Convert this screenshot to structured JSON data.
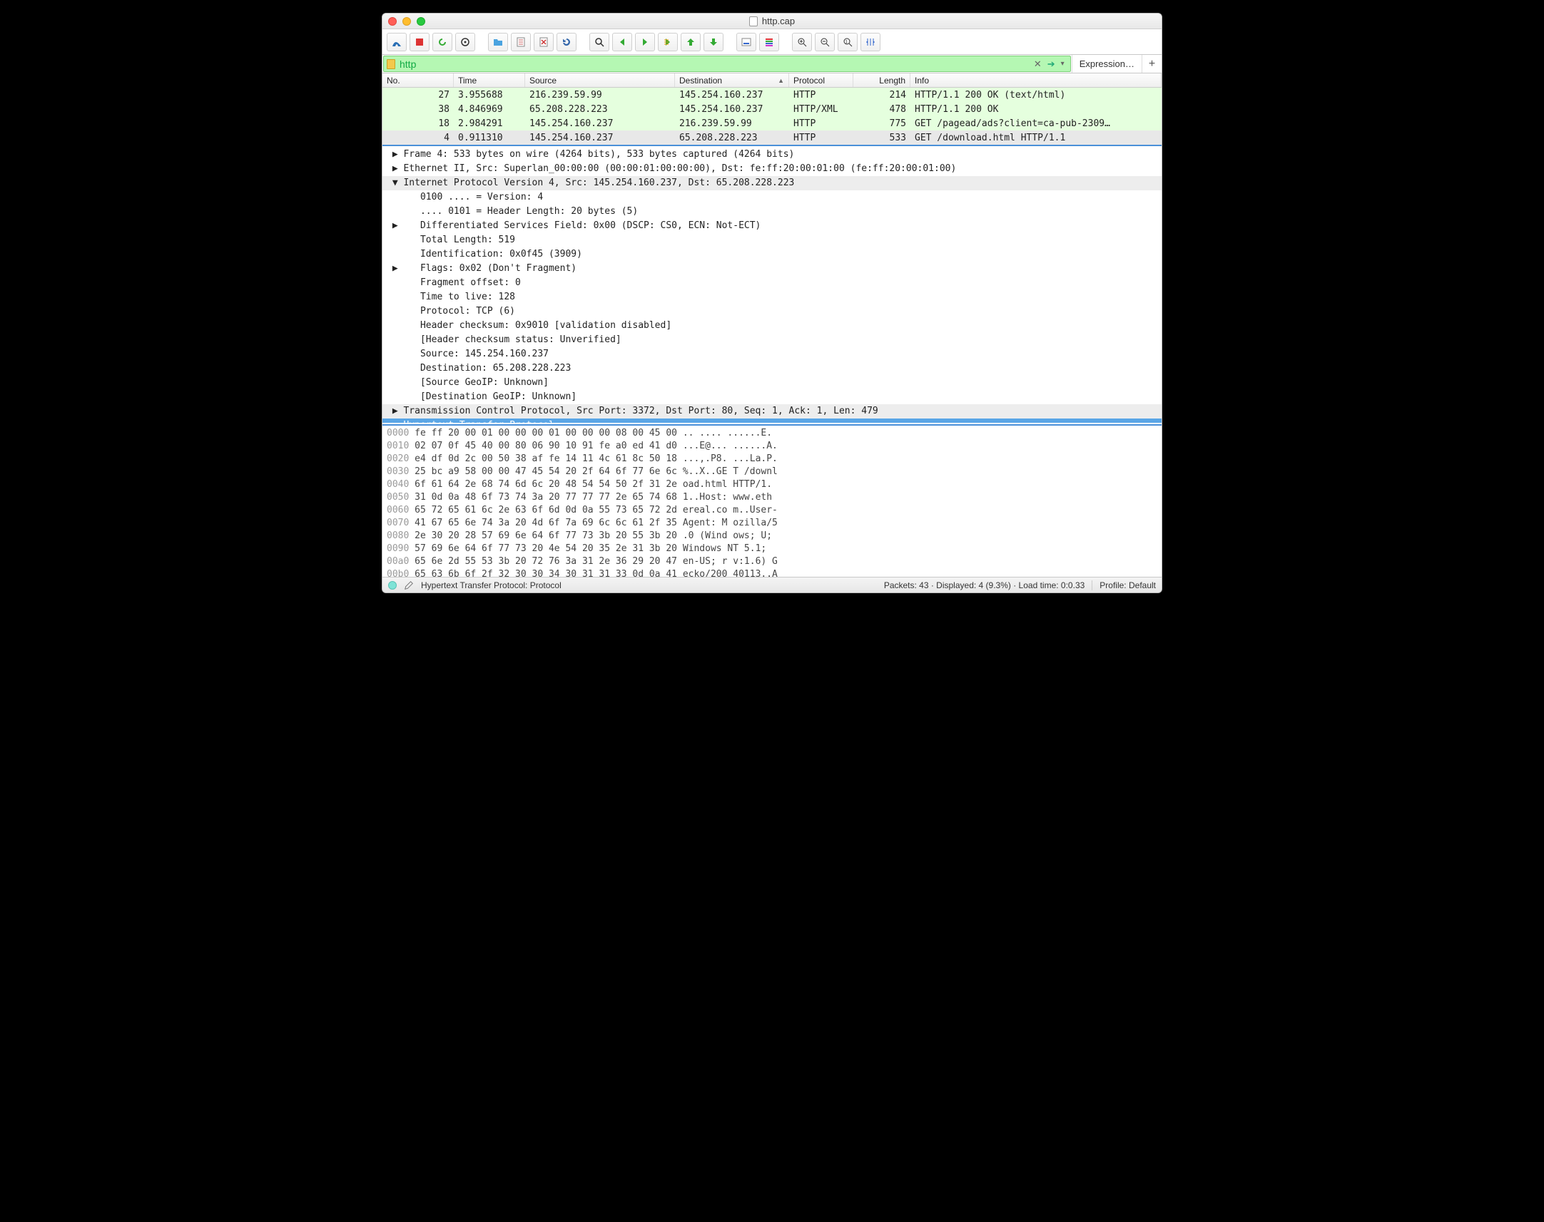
{
  "window": {
    "title": "http.cap"
  },
  "filter": {
    "value": "http",
    "expression_label": "Expression…"
  },
  "columns": {
    "no": "No.",
    "time": "Time",
    "source": "Source",
    "destination": "Destination",
    "protocol": "Protocol",
    "length": "Length",
    "info": "Info"
  },
  "packets": [
    {
      "no": "27",
      "time": "3.955688",
      "src": "216.239.59.99",
      "dst": "145.254.160.237",
      "proto": "HTTP",
      "len": "214",
      "info": "HTTP/1.1 200 OK  (text/html)",
      "cls": "green"
    },
    {
      "no": "38",
      "time": "4.846969",
      "src": "65.208.228.223",
      "dst": "145.254.160.237",
      "proto": "HTTP/XML",
      "len": "478",
      "info": "HTTP/1.1 200 OK",
      "cls": "green"
    },
    {
      "no": "18",
      "time": "2.984291",
      "src": "145.254.160.237",
      "dst": "216.239.59.99",
      "proto": "HTTP",
      "len": "775",
      "info": "GET /pagead/ads?client=ca-pub-2309…",
      "cls": "green"
    },
    {
      "no": "4",
      "time": "0.911310",
      "src": "145.254.160.237",
      "dst": "65.208.228.223",
      "proto": "HTTP",
      "len": "533",
      "info": "GET /download.html HTTP/1.1",
      "cls": "sel"
    }
  ],
  "details": [
    {
      "t": "▶",
      "indent": 0,
      "text": "Frame 4: 533 bytes on wire (4264 bits), 533 bytes captured (4264 bits)"
    },
    {
      "t": "▶",
      "indent": 0,
      "text": "Ethernet II, Src: Superlan_00:00:00 (00:00:01:00:00:00), Dst: fe:ff:20:00:01:00 (fe:ff:20:00:01:00)"
    },
    {
      "t": "▼",
      "indent": 0,
      "text": "Internet Protocol Version 4, Src: 145.254.160.237, Dst: 65.208.228.223",
      "hdr": true
    },
    {
      "t": "",
      "indent": 1,
      "text": "0100 .... = Version: 4"
    },
    {
      "t": "",
      "indent": 1,
      "text": ".... 0101 = Header Length: 20 bytes (5)"
    },
    {
      "t": "▶",
      "indent": 1,
      "text": "Differentiated Services Field: 0x00 (DSCP: CS0, ECN: Not-ECT)"
    },
    {
      "t": "",
      "indent": 1,
      "text": "Total Length: 519"
    },
    {
      "t": "",
      "indent": 1,
      "text": "Identification: 0x0f45 (3909)"
    },
    {
      "t": "▶",
      "indent": 1,
      "text": "Flags: 0x02 (Don't Fragment)"
    },
    {
      "t": "",
      "indent": 1,
      "text": "Fragment offset: 0"
    },
    {
      "t": "",
      "indent": 1,
      "text": "Time to live: 128"
    },
    {
      "t": "",
      "indent": 1,
      "text": "Protocol: TCP (6)"
    },
    {
      "t": "",
      "indent": 1,
      "text": "Header checksum: 0x9010 [validation disabled]"
    },
    {
      "t": "",
      "indent": 1,
      "text": "[Header checksum status: Unverified]"
    },
    {
      "t": "",
      "indent": 1,
      "text": "Source: 145.254.160.237"
    },
    {
      "t": "",
      "indent": 1,
      "text": "Destination: 65.208.228.223"
    },
    {
      "t": "",
      "indent": 1,
      "text": "[Source GeoIP: Unknown]"
    },
    {
      "t": "",
      "indent": 1,
      "text": "[Destination GeoIP: Unknown]"
    },
    {
      "t": "▶",
      "indent": 0,
      "text": "Transmission Control Protocol, Src Port: 3372, Dst Port: 80, Seq: 1, Ack: 1, Len: 479",
      "hdr": true
    }
  ],
  "bytes": [
    {
      "off": "0000",
      "hex": "fe ff 20 00 01 00 00 00  01 00 00 00 08 00 45 00",
      "ascii": ".. .... ......E."
    },
    {
      "off": "0010",
      "hex": "02 07 0f 45 40 00 80 06  90 10 91 fe a0 ed 41 d0",
      "ascii": "...E@... ......A."
    },
    {
      "off": "0020",
      "hex": "e4 df 0d 2c 00 50 38 af  fe 14 11 4c 61 8c 50 18",
      "ascii": "...,.P8. ...La.P."
    },
    {
      "off": "0030",
      "hex": "25 bc a9 58 00 00 47 45  54 20 2f 64 6f 77 6e 6c",
      "ascii": "%..X..GE T /downl"
    },
    {
      "off": "0040",
      "hex": "6f 61 64 2e 68 74 6d 6c  20 48 54 54 50 2f 31 2e",
      "ascii": "oad.html  HTTP/1."
    },
    {
      "off": "0050",
      "hex": "31 0d 0a 48 6f 73 74 3a  20 77 77 77 2e 65 74 68",
      "ascii": "1..Host:  www.eth"
    },
    {
      "off": "0060",
      "hex": "65 72 65 61 6c 2e 63 6f  6d 0d 0a 55 73 65 72 2d",
      "ascii": "ereal.co m..User-"
    },
    {
      "off": "0070",
      "hex": "41 67 65 6e 74 3a 20 4d  6f 7a 69 6c 6c 61 2f 35",
      "ascii": "Agent: M ozilla/5"
    },
    {
      "off": "0080",
      "hex": "2e 30 20 28 57 69 6e 64  6f 77 73 3b 20 55 3b 20",
      "ascii": ".0 (Wind ows; U; "
    },
    {
      "off": "0090",
      "hex": "57 69 6e 64 6f 77 73 20  4e 54 20 35 2e 31 3b 20",
      "ascii": "Windows  NT 5.1; "
    },
    {
      "off": "00a0",
      "hex": "65 6e 2d 55 53 3b 20 72  76 3a 31 2e 36 29 20 47",
      "ascii": "en-US; r v:1.6) G"
    },
    {
      "off": "00b0",
      "hex": "65 63 6b 6f 2f 32 30 30  34 30 31 31 33 0d 0a 41",
      "ascii": "ecko/200 40113..A"
    }
  ],
  "status": {
    "left": "Hypertext Transfer Protocol: Protocol",
    "right": "Packets: 43 · Displayed: 4 (9.3%) · Load time: 0:0.33",
    "profile": "Profile: Default"
  },
  "icons": {
    "shark": "shark",
    "stop": "stop",
    "restart": "restart",
    "options": "options",
    "open": "open",
    "save": "save",
    "close": "close",
    "reload": "reload",
    "find": "find",
    "prev": "prev",
    "next": "next",
    "goto": "goto",
    "first": "first",
    "last": "last",
    "autoscroll": "autoscroll",
    "colorize": "colorize",
    "zoomIn": "zoomIn",
    "zoomOut": "zoomOut",
    "zoom1": "zoom1",
    "resize": "resize"
  }
}
